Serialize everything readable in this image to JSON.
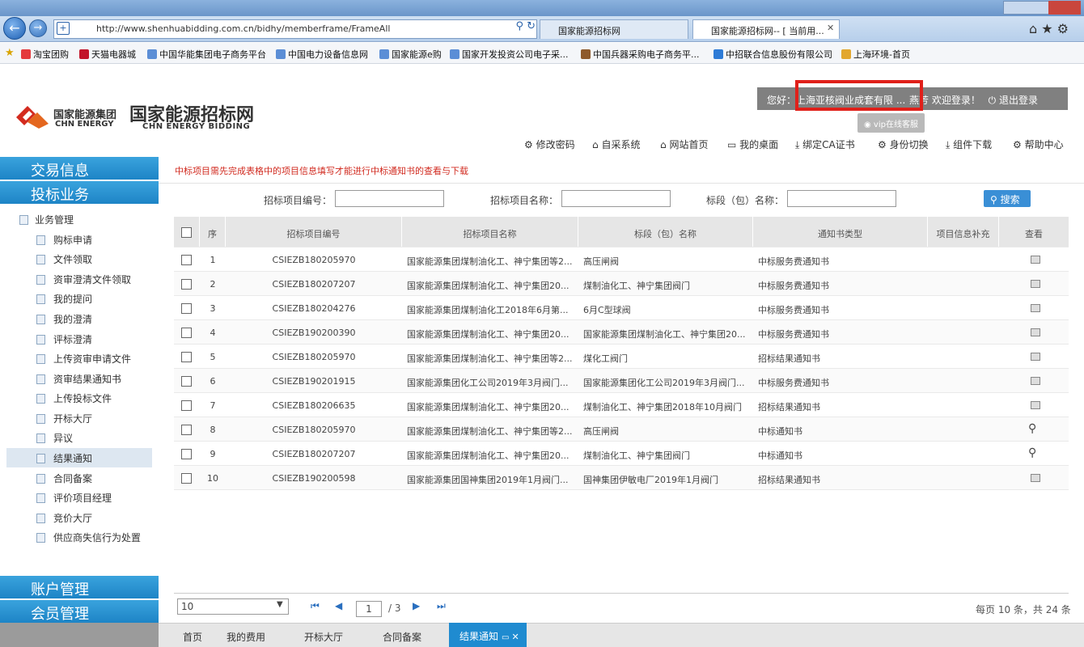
{
  "browser": {
    "url": "http://www.shenhuabidding.com.cn/bidhy/memberframe/FrameAll",
    "tabs": [
      {
        "label": "国家能源招标网"
      },
      {
        "label": "国家能源招标网-- [ 当前用..."
      }
    ],
    "favorites": [
      "淘宝团购",
      "天猫电器城",
      "中国华能集团电子商务平台",
      "中国电力设备信息网",
      "国家能源e购",
      "国家开发投资公司电子采...",
      "中国兵器采购电子商务平...",
      "中招联合信息股份有限公司",
      "上海环境-首页"
    ]
  },
  "header": {
    "logo_group_cn": "国家能源集团",
    "logo_group_en": "CHN ENERGY",
    "site_title": "国家能源招标网",
    "site_title_en": "CHN ENERGY BIDDING",
    "welcome_prefix": "您好：",
    "user_company": "上海亚核阀业成套有限 ...",
    "welcome_suffix": "燕芳 欢迎登录！",
    "logout": "退出登录",
    "vip_label": "vip在线客服",
    "links": [
      "修改密码",
      "自采系统",
      "网站首页",
      "我的桌面",
      "绑定CA证书",
      "身份切换",
      "组件下载",
      "帮助中心"
    ]
  },
  "sidebar": {
    "heads": {
      "trade": "交易信息",
      "bid": "投标业务",
      "account": "账户管理",
      "member": "会员管理"
    },
    "group": "业务管理",
    "items": [
      "购标申请",
      "文件领取",
      "资审澄清文件领取",
      "我的提问",
      "我的澄清",
      "评标澄清",
      "上传资审申请文件",
      "资审结果通知书",
      "上传投标文件",
      "开标大厅",
      "异议",
      "结果通知",
      "合同备案",
      "评价项目经理",
      "竞价大厅",
      "供应商失信行为处置"
    ],
    "active_item": "结果通知"
  },
  "main": {
    "notice": "中标项目需先完成表格中的项目信息填写才能进行中标通知书的查看与下载",
    "filters": {
      "project_no": "招标项目编号：",
      "project_name": "招标项目名称：",
      "section_name": "标段（包）名称："
    },
    "search_button": "搜索",
    "columns": [
      "序",
      "招标项目编号",
      "招标项目名称",
      "标段（包）名称",
      "通知书类型",
      "项目信息补充",
      "查看"
    ],
    "rows": [
      {
        "no": "1",
        "code": "CSIEZB180205970",
        "name": "国家能源集团煤制油化工、神宁集团等2...",
        "section": "高压闸阀",
        "type": "中标服务费通知书",
        "view": "print"
      },
      {
        "no": "2",
        "code": "CSIEZB180207207",
        "name": "国家能源集团煤制油化工、神宁集团20...",
        "section": "煤制油化工、神宁集团阀门",
        "type": "中标服务费通知书",
        "view": "print"
      },
      {
        "no": "3",
        "code": "CSIEZB180204276",
        "name": "国家能源集团煤制油化工2018年6月第...",
        "section": "6月C型球阀",
        "type": "中标服务费通知书",
        "view": "print"
      },
      {
        "no": "4",
        "code": "CSIEZB190200390",
        "name": "国家能源集团煤制油化工、神宁集团20...",
        "section": "国家能源集团煤制油化工、神宁集团20...",
        "type": "中标服务费通知书",
        "view": "print"
      },
      {
        "no": "5",
        "code": "CSIEZB180205970",
        "name": "国家能源集团煤制油化工、神宁集团等2...",
        "section": "煤化工阀门",
        "type": "招标结果通知书",
        "view": "print"
      },
      {
        "no": "6",
        "code": "CSIEZB190201915",
        "name": "国家能源集团化工公司2019年3月阀门...",
        "section": "国家能源集团化工公司2019年3月阀门...",
        "type": "中标服务费通知书",
        "view": "print"
      },
      {
        "no": "7",
        "code": "CSIEZB180206635",
        "name": "国家能源集团煤制油化工、神宁集团20...",
        "section": "煤制油化工、神宁集团2018年10月阀门",
        "type": "招标结果通知书",
        "view": "print"
      },
      {
        "no": "8",
        "code": "CSIEZB180205970",
        "name": "国家能源集团煤制油化工、神宁集团等2...",
        "section": "高压闸阀",
        "type": "中标通知书",
        "view": "search"
      },
      {
        "no": "9",
        "code": "CSIEZB180207207",
        "name": "国家能源集团煤制油化工、神宁集团20...",
        "section": "煤制油化工、神宁集团阀门",
        "type": "中标通知书",
        "view": "search"
      },
      {
        "no": "10",
        "code": "CSIEZB190200598",
        "name": "国家能源集团国神集团2019年1月阀门...",
        "section": "国神集团伊敏电厂2019年1月阀门",
        "type": "招标结果通知书",
        "view": "print"
      }
    ]
  },
  "pager": {
    "page_size": "10",
    "current_page": "1",
    "total_pages": "/ 3",
    "summary": "每页 10 条，共 24 条"
  },
  "bottom_tabs": [
    "首页",
    "我的费用",
    "开标大厅",
    "合同备案"
  ],
  "active_bottom_tab": "结果通知",
  "colors": {
    "accent": "#1d84c6",
    "notice": "#d12a1f",
    "highlight": "#e0201a"
  }
}
